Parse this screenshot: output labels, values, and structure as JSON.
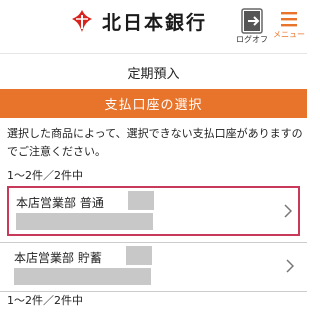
{
  "header": {
    "bank_name": "北日本銀行",
    "logoff_label": "ログオフ",
    "menu_label": "メニュー",
    "brand_color": "#e8742c",
    "logo_color": "#d8231f"
  },
  "page": {
    "title": "定期預入"
  },
  "section": {
    "title": "支払口座の選択"
  },
  "notice": {
    "text": "選択した商品によって、選択できない支払口座がありますのでご注意ください。"
  },
  "counts": {
    "top": "1〜2件／2件中",
    "bottom": "1〜2件／2件中"
  },
  "accounts": [
    {
      "label": "本店営業部 普通",
      "selected": true
    },
    {
      "label": "本店営業部 貯蓄",
      "selected": false
    }
  ],
  "icons": {
    "logo": "bank-logo-icon",
    "logoff": "logoff-icon",
    "menu": "hamburger-menu-icon",
    "chevron": "chevron-right-icon"
  },
  "colors": {
    "selected_border": "#c93a5a",
    "redaction": "#c8c8c8"
  }
}
